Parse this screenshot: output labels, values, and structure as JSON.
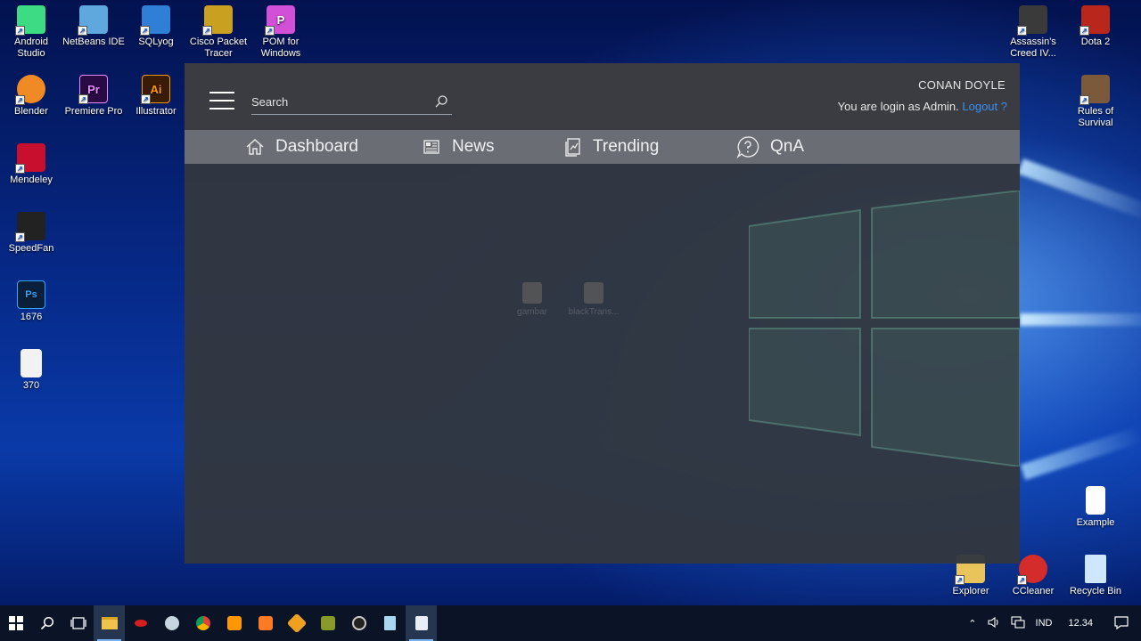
{
  "desktop": {
    "left_icons": [
      {
        "label": "Android Studio",
        "icon": "android-studio-icon",
        "color": "#3ddc84"
      },
      {
        "label": "NetBeans IDE",
        "icon": "netbeans-icon",
        "color": "#5fa8dd"
      },
      {
        "label": "SQLyog",
        "icon": "sqlyog-icon",
        "color": "#2f7fd6"
      },
      {
        "label": "Cisco Packet Tracer",
        "icon": "cisco-packet-tracer-icon",
        "color": "#c9a020"
      },
      {
        "label": "POM for Windows",
        "icon": "pom-icon",
        "color": "#d24fd8"
      },
      {
        "label": "Blender",
        "icon": "blender-icon",
        "color": "#f08a24"
      },
      {
        "label": "Premiere Pro",
        "icon": "premiere-pro-icon",
        "color": "#2a0a45"
      },
      {
        "label": "Illustrator",
        "icon": "illustrator-icon",
        "color": "#3a1b06"
      },
      {
        "label": "Mendeley",
        "icon": "mendeley-icon",
        "color": "#c8102e"
      },
      {
        "label": "SpeedFan",
        "icon": "speedfan-icon",
        "color": "#222222"
      },
      {
        "label": "1676",
        "icon": "photoshop-file-icon",
        "color": "#0a1f3a"
      },
      {
        "label": "370",
        "icon": "eps-file-icon",
        "color": "#f2f2f2"
      }
    ],
    "right_icons": [
      {
        "label": "Assassin's Creed IV...",
        "icon": "assassins-creed-icon",
        "color": "#3a3a3a"
      },
      {
        "label": "Dota 2",
        "icon": "dota2-icon",
        "color": "#b8261c"
      },
      {
        "label": "Rules of Survival",
        "icon": "rules-of-survival-icon",
        "color": "#7a5a3a"
      },
      {
        "label": "Example",
        "icon": "text-file-icon",
        "color": "#ffffff"
      },
      {
        "label": "Explorer",
        "icon": "explorer-icon",
        "color": "#e8c45a"
      },
      {
        "label": "CCleaner",
        "icon": "ccleaner-icon",
        "color": "#d42b2b"
      },
      {
        "label": "Recycle Bin",
        "icon": "recycle-bin-icon",
        "color": "#cfe6ff"
      }
    ]
  },
  "app": {
    "search_placeholder": "Search",
    "user_name": "CONAN DOYLE",
    "login_text": "You are login as Admin.",
    "logout_label": "Logout ?",
    "accent_color": "#3a8ef0",
    "nav": [
      {
        "label": "Dashboard",
        "icon": "home-icon"
      },
      {
        "label": "News",
        "icon": "newspaper-icon"
      },
      {
        "label": "Trending",
        "icon": "trending-icon"
      },
      {
        "label": "QnA",
        "icon": "question-icon"
      }
    ],
    "ghost_items": [
      "gambar",
      "blackTrans..."
    ]
  },
  "taskbar": {
    "apps": [
      "start-icon",
      "search-icon",
      "task-view-icon",
      "file-explorer-icon",
      "msi-icon",
      "steam-icon",
      "chrome-icon",
      "sublime-icon",
      "xampp-icon",
      "app-icon",
      "app2-icon",
      "obs-icon",
      "notepad-icon",
      "java-icon"
    ],
    "language": "IND",
    "time": "12.34"
  }
}
